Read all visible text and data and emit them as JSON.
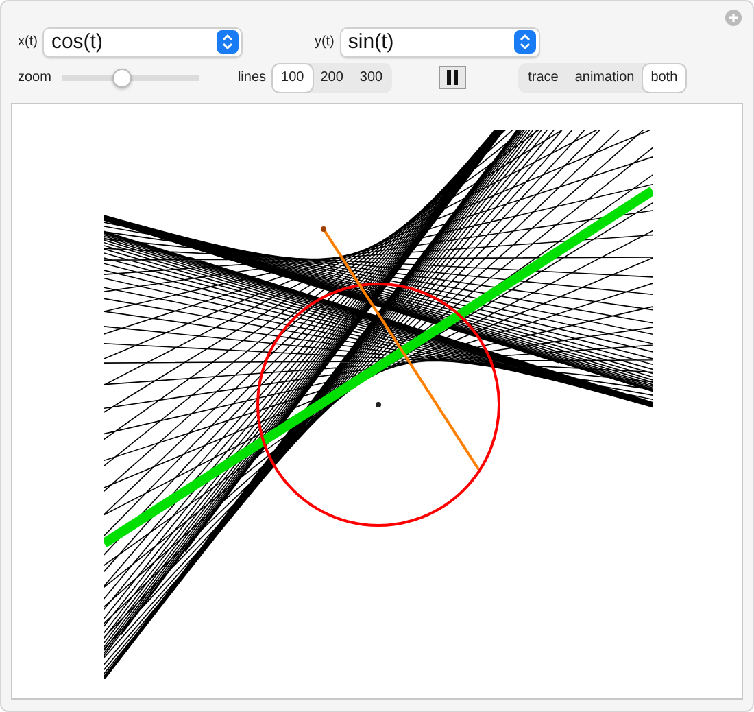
{
  "selectors": [
    {
      "label": "x(t)",
      "value": "cos(t)"
    },
    {
      "label": "y(t)",
      "value": "sin(t)"
    }
  ],
  "zoom": {
    "label": "zoom",
    "level": 0.44
  },
  "lines": {
    "label": "lines",
    "options": [
      {
        "label": "100",
        "selected": true
      },
      {
        "label": "200",
        "selected": false
      },
      {
        "label": "300",
        "selected": false
      }
    ]
  },
  "playback": {
    "paused": false
  },
  "mode": {
    "options": [
      {
        "label": "trace",
        "selected": false
      },
      {
        "label": "animation",
        "selected": false
      },
      {
        "label": "both",
        "selected": true
      }
    ]
  }
}
